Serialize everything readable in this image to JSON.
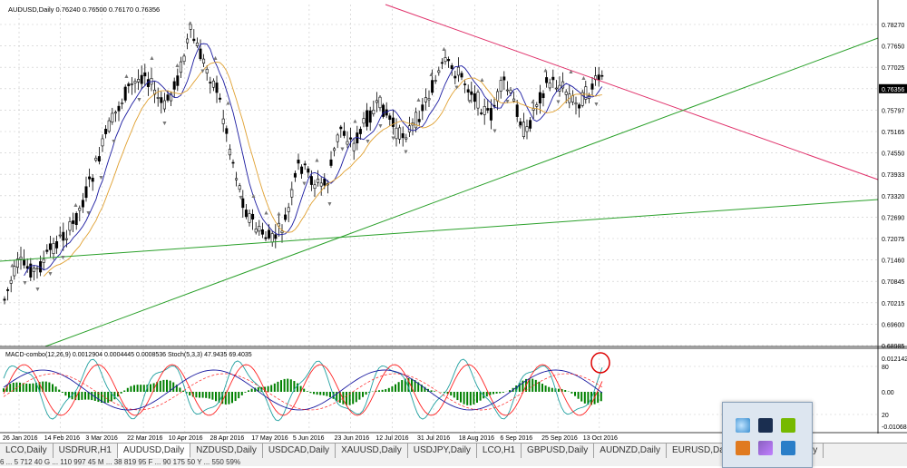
{
  "window": {
    "chart_header": "AUDUSD,Daily  0.76240 0.76500 0.76170 0.76356",
    "current_price": "0.76356"
  },
  "price_axis": [
    "0.78270",
    "0.77650",
    "0.77025",
    "0.76356",
    "0.75797",
    "0.75165",
    "0.74550",
    "0.73933",
    "0.73320",
    "0.72690",
    "0.72075",
    "0.71460",
    "0.70845",
    "0.70215",
    "0.69600",
    "0.68985"
  ],
  "indicator": {
    "header": "MACD-combo(12,26,9) 0.0012904 0.0004445 0.0008536  Stoch(5,3,3) 47.9435 69.4035",
    "axis": [
      "0.012142",
      "80",
      "0.00",
      "20",
      "-0.010683"
    ]
  },
  "time_axis": [
    "26 Jan 2016",
    "14 Feb 2016",
    "3 Mar 2016",
    "22 Mar 2016",
    "10 Apr 2016",
    "28 Apr 2016",
    "17 May 2016",
    "5 Jun 2016",
    "23 Jun 2016",
    "12 Jul 2016",
    "31 Jul 2016",
    "18 Aug 2016",
    "6 Sep 2016",
    "25 Sep 2016",
    "13 Oct 2016"
  ],
  "tabs": [
    {
      "label": "LCO,Daily",
      "active": false
    },
    {
      "label": "USDRUR,H1",
      "active": false
    },
    {
      "label": "AUDUSD,Daily",
      "active": true
    },
    {
      "label": "NZDUSD,Daily",
      "active": false
    },
    {
      "label": "USDCAD,Daily",
      "active": false
    },
    {
      "label": "XAUUSD,Daily",
      "active": false
    },
    {
      "label": "USDJPY,Daily",
      "active": false
    },
    {
      "label": "LCO,H1",
      "active": false
    },
    {
      "label": "GBPUSD,Daily",
      "active": false
    },
    {
      "label": "AUDNZD,Daily",
      "active": false
    },
    {
      "label": "EURUSD,Daily",
      "active": false
    },
    {
      "label": "AUDUSD,Monthly",
      "active": false
    }
  ],
  "status": "6 ... 5 712 40   G ...   110 997 45   M ...   38 819 95   F ...   90 175 50   Y ...   550 59%",
  "colors": {
    "bull": "#000000",
    "grid": "#c8c8c8",
    "trend_red": "#e0306a",
    "trend_green": "#2aa02a",
    "ma_fast": "#1a1aa0",
    "ma_slow": "#e0a030",
    "hist": "#008000",
    "stoch_main": "#20a0a0",
    "stoch_signal": "#ff2020",
    "circle": "#dd0000"
  },
  "tray_icons": [
    "cloud-icon",
    "monitor-icon",
    "nvidia-icon",
    "java-icon",
    "pen-icon",
    "network-icon"
  ]
}
